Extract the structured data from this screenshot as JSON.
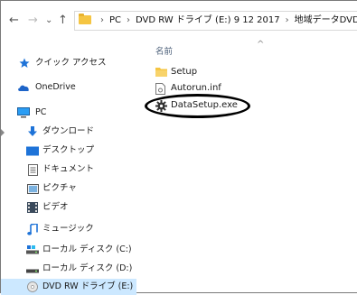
{
  "address_bar": {
    "path": [
      "PC",
      "DVD RW ドライブ (E:) 9 12 2017",
      "地域データDVD"
    ]
  },
  "nav": {
    "back_glyph": "←",
    "forward_glyph": "→",
    "history_glyph": "⌄",
    "up_glyph": "↑",
    "separator": "›"
  },
  "sidebar": {
    "items": [
      {
        "label": "クイック アクセス",
        "icon": "star-icon"
      },
      {
        "label": "OneDrive",
        "icon": "cloud-icon"
      },
      {
        "label": "PC",
        "icon": "pc-icon"
      },
      {
        "label": "ダウンロード",
        "icon": "download-icon"
      },
      {
        "label": "デスクトップ",
        "icon": "desktop-icon"
      },
      {
        "label": "ドキュメント",
        "icon": "document-icon"
      },
      {
        "label": "ピクチャ",
        "icon": "pictures-icon"
      },
      {
        "label": "ビデオ",
        "icon": "video-icon"
      },
      {
        "label": "ミュージック",
        "icon": "music-icon"
      },
      {
        "label": "ローカル ディスク (C:)",
        "icon": "local-disk-icon"
      },
      {
        "label": "ローカル ディスク (D:)",
        "icon": "local-disk-icon"
      },
      {
        "label": "DVD RW ドライブ (E:)",
        "icon": "dvd-drive-icon"
      }
    ]
  },
  "content": {
    "column_name": "名前",
    "sort_glyph": "^",
    "files": [
      {
        "name": "Setup",
        "icon": "folder-icon"
      },
      {
        "name": "Autorun.inf",
        "icon": "settings-file-icon"
      },
      {
        "name": "DataSetup.exe",
        "icon": "gear-icon"
      }
    ]
  },
  "colors": {
    "selection": "#cce8ff",
    "folder": "#f5c542",
    "accent": "#1e73d8"
  }
}
